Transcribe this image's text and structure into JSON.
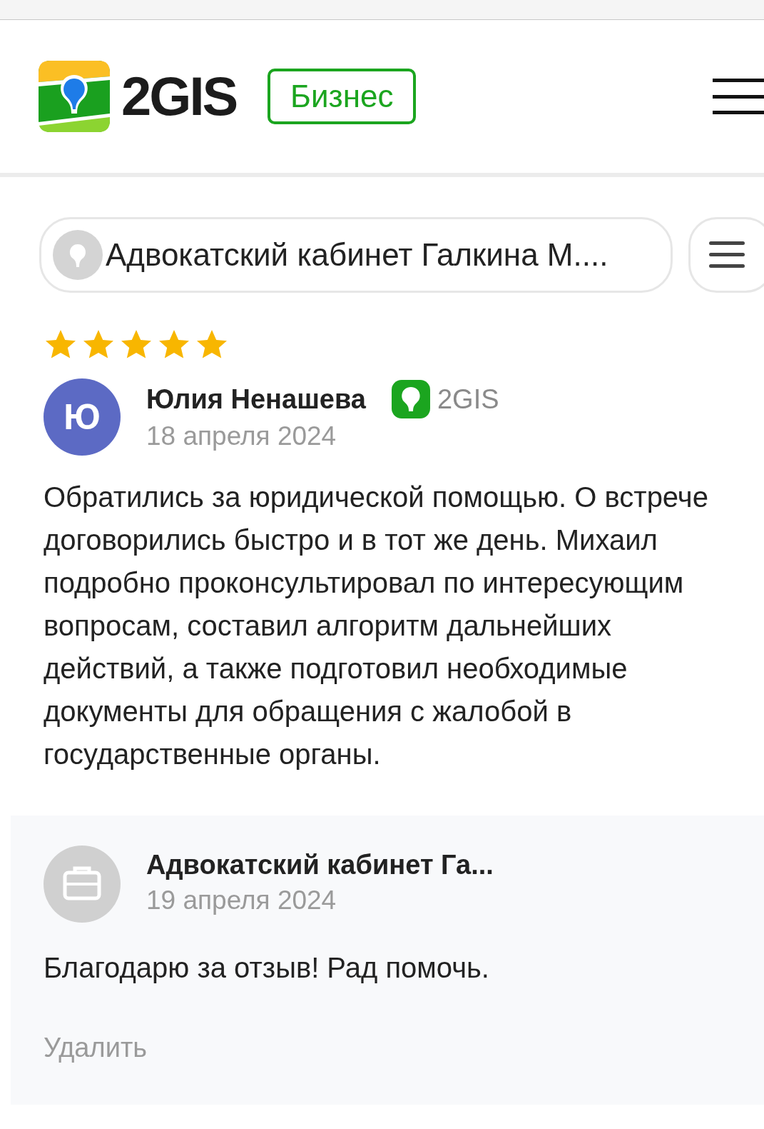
{
  "header": {
    "logo_text": "2GIS",
    "badge": "Бизнес"
  },
  "organization": {
    "name": "Адвокатский кабинет Галкина М...."
  },
  "review": {
    "stars": 5,
    "author": {
      "initial": "Ю",
      "name": "Юлия Ненашева",
      "source": "2GIS"
    },
    "date": "18 апреля 2024",
    "text": "Обратились за юридической помощью. О встрече договорились быстро и в тот же день. Михаил подробно проконсультировал по интересующим вопросам, составил алгоритм дальнейших действий, а также подготовил необходимые документы для обращения с жалобой в государственные органы."
  },
  "reply": {
    "author": "Адвокатский кабинет Га...",
    "date": "19 апреля 2024",
    "text": "Благодарю за отзыв! Рад помочь.",
    "delete_label": "Удалить"
  }
}
